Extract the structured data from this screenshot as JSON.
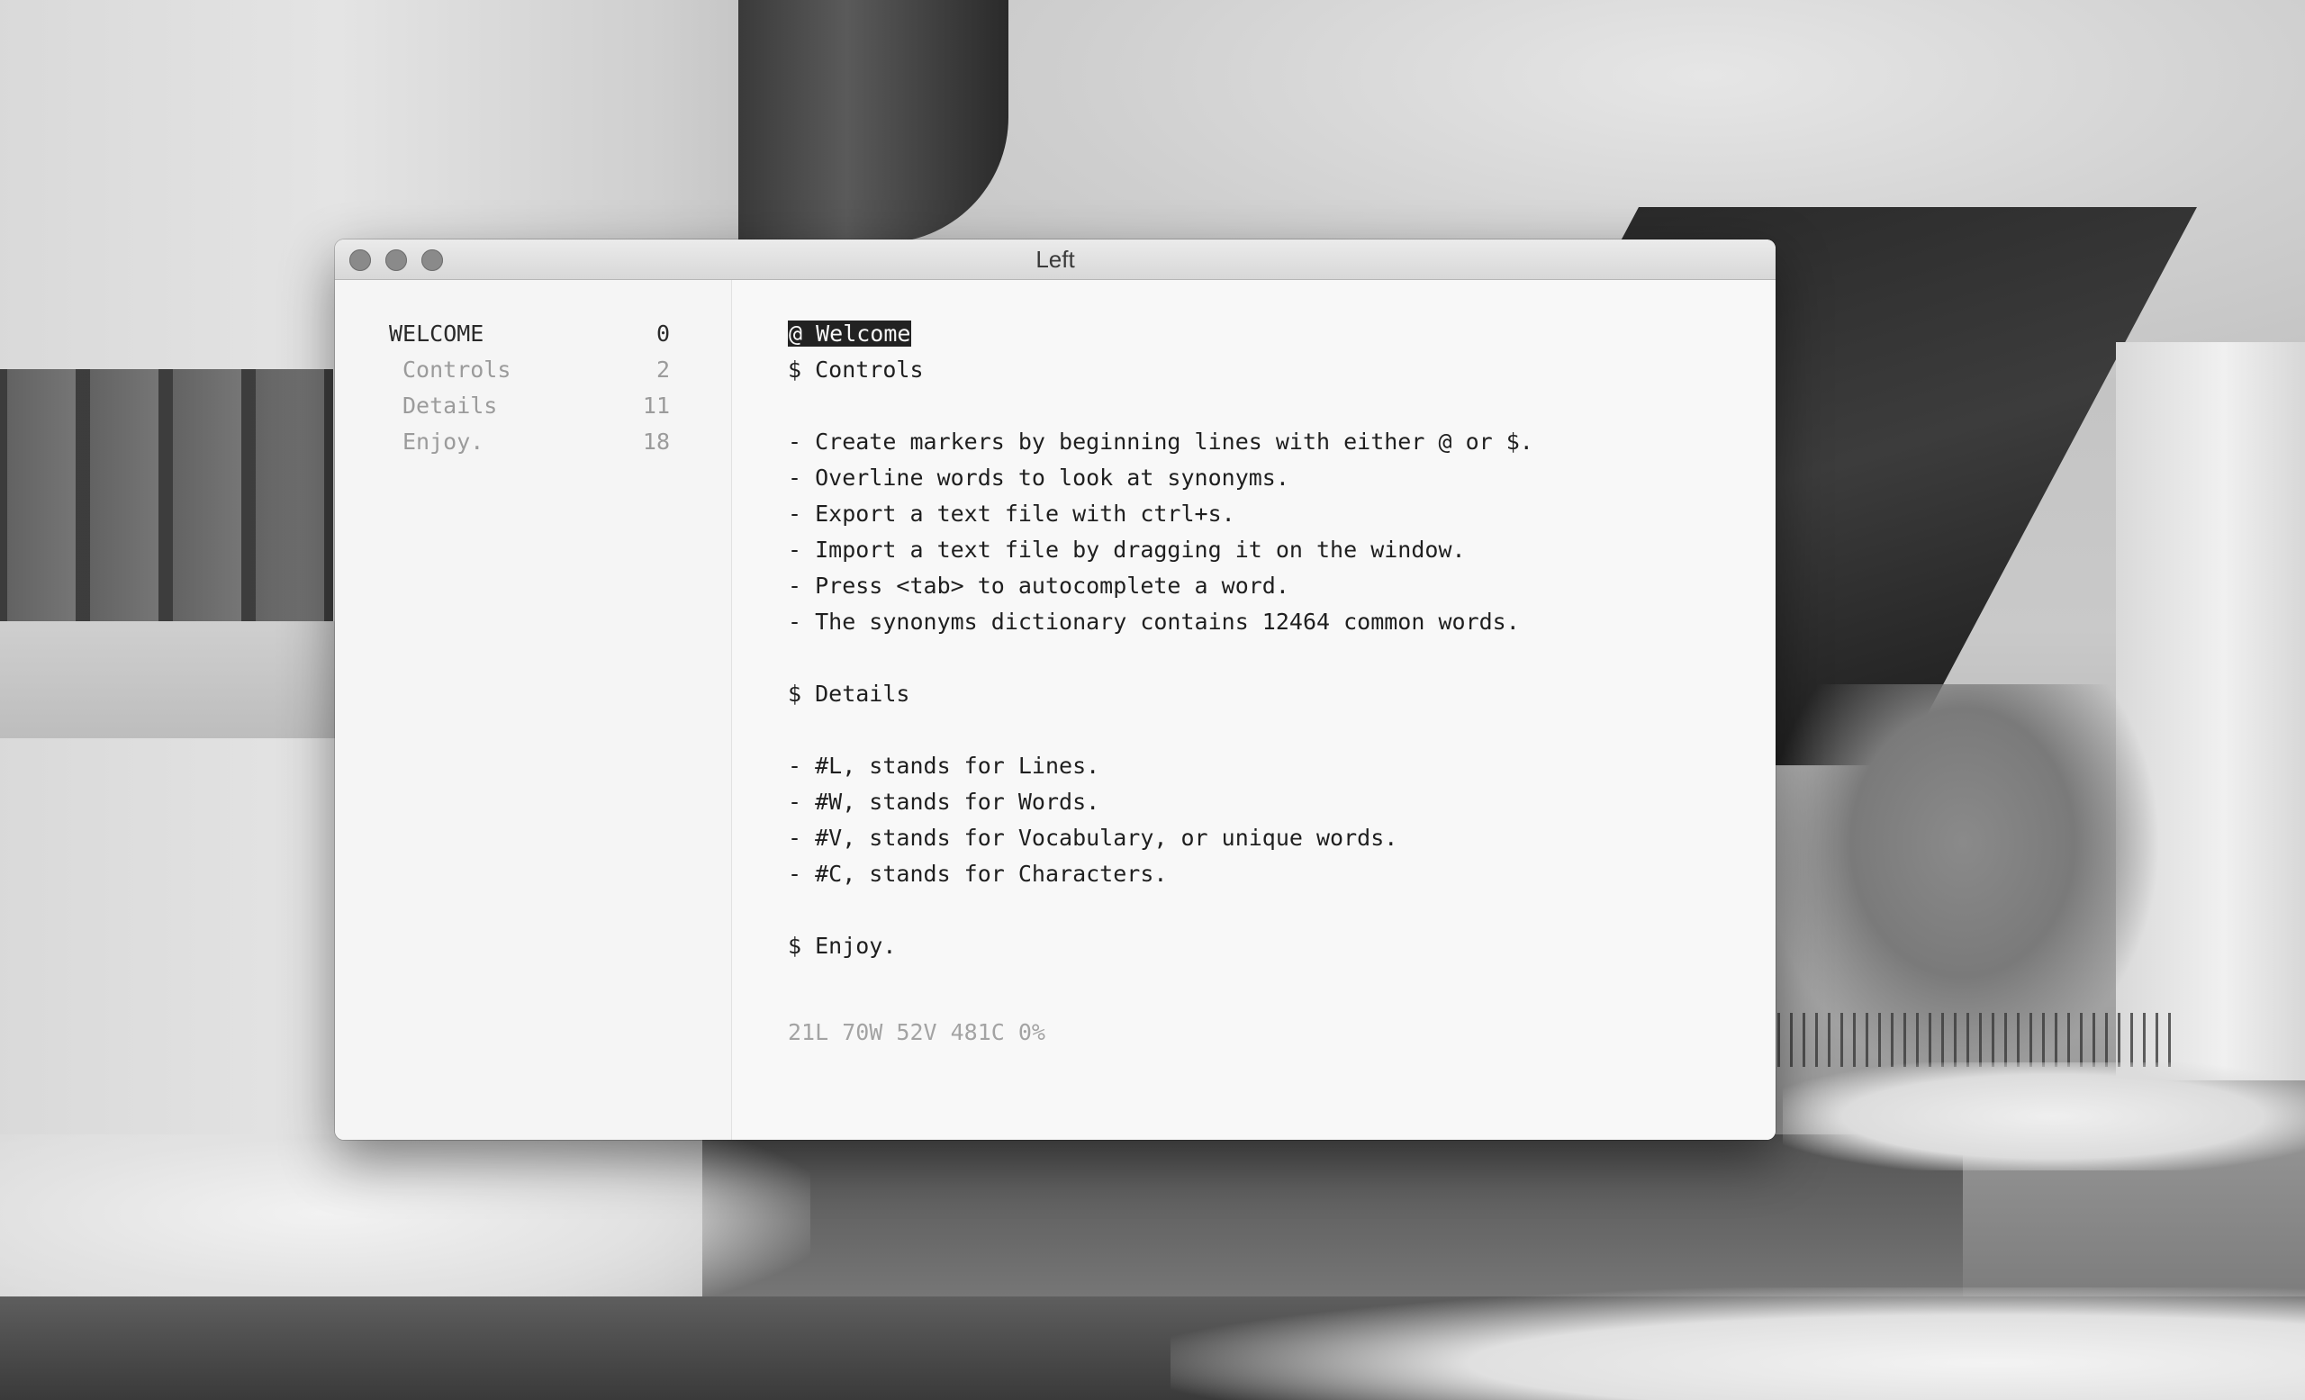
{
  "window": {
    "title": "Left"
  },
  "sidebar": {
    "items": [
      {
        "label": "WELCOME",
        "count": "0",
        "active": true
      },
      {
        "label": "Controls",
        "count": "2",
        "active": false
      },
      {
        "label": "Details",
        "count": "11",
        "active": false
      },
      {
        "label": "Enjoy.",
        "count": "18",
        "active": false
      }
    ]
  },
  "editor": {
    "selected_marker": "@ Welcome",
    "lines": [
      "$ Controls",
      "- Create markers by beginning lines with either @ or $.",
      "- Overline words to look at synonyms.",
      "- Export a text file with ctrl+s.",
      "- Import a text file by dragging it on the window.",
      "- Press <tab> to autocomplete a word.",
      "- The synonyms dictionary contains 12464 common words.",
      "$ Details",
      "- #L, stands for Lines.",
      "- #W, stands for Words.",
      "- #V, stands for Vocabulary, or unique words.",
      "- #C, stands for Characters.",
      "$ Enjoy."
    ]
  },
  "status": {
    "text": "21L 70W 52V 481C 0%"
  },
  "colors": {
    "window_bg": "#f8f8f8",
    "text": "#1f1f1f",
    "muted": "#9b9b9b",
    "selection_bg": "#222222"
  }
}
